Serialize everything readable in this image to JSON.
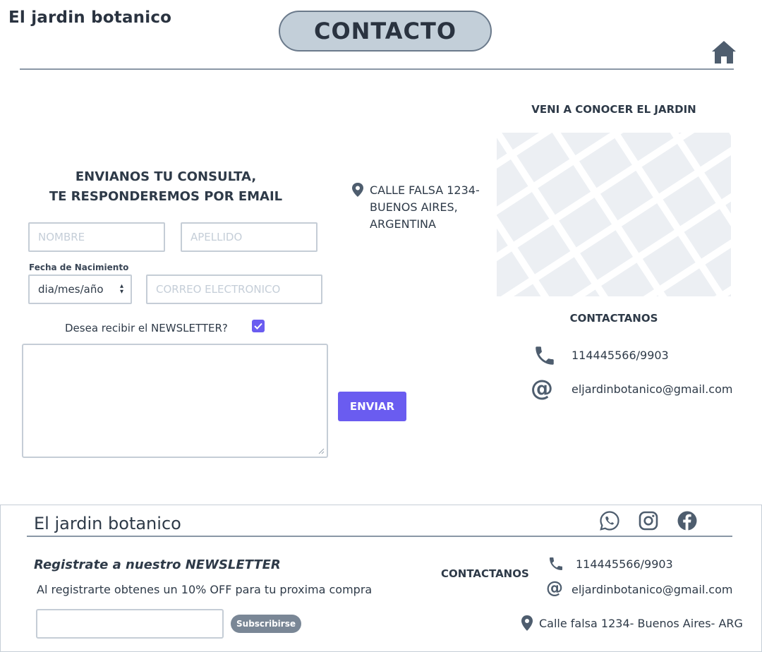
{
  "header": {
    "brand": "El jardin botanico",
    "page_title": "CONTACTO"
  },
  "form": {
    "heading_line1": "ENVIANOS TU CONSULTA,",
    "heading_line2": "TE RESPONDEREMOS POR EMAIL",
    "nombre_placeholder": "NOMBRE",
    "apellido_placeholder": "APELLIDO",
    "fecha_label": "Fecha de Nacimiento",
    "fecha_value": "dia/mes/año",
    "correo_placeholder": "CORREO ELECTRONICO",
    "newsletter_label": "Desea  recibir el NEWSLETTER?",
    "newsletter_checked": true,
    "message_value": "",
    "submit_label": "ENVIAR"
  },
  "address": {
    "line1": "CALLE FALSA 1234-",
    "line2": "BUENOS AIRES,",
    "line3": "ARGENTINA"
  },
  "visit": {
    "heading": "VENI A CONOCER EL JARDIN"
  },
  "contact": {
    "heading": "CONTACTANOS",
    "phone": "114445566/9903",
    "email": "eljardinbotanico@gmail.com"
  },
  "footer": {
    "brand": "El jardin botanico",
    "newsletter_title": "Registrate a nuestro NEWSLETTER",
    "newsletter_sub": "Al registrarte obtenes un 10% OFF para tu proxima compra",
    "subscribe_input_value": "",
    "subscribe_label": "Subscribirse",
    "contact_heading": "CONTACTANOS",
    "phone": "114445566/9903",
    "email": "eljardinbotanico@gmail.com",
    "address": "Calle falsa 1234- Buenos Aires- ARG",
    "social_icons": [
      "whatsapp-icon",
      "instagram-icon",
      "facebook-icon"
    ]
  },
  "colors": {
    "accent": "#6a5cf0",
    "title_pill": "#c3cfd9",
    "text": "#2e3a48",
    "icon": "#4e5d6e"
  }
}
